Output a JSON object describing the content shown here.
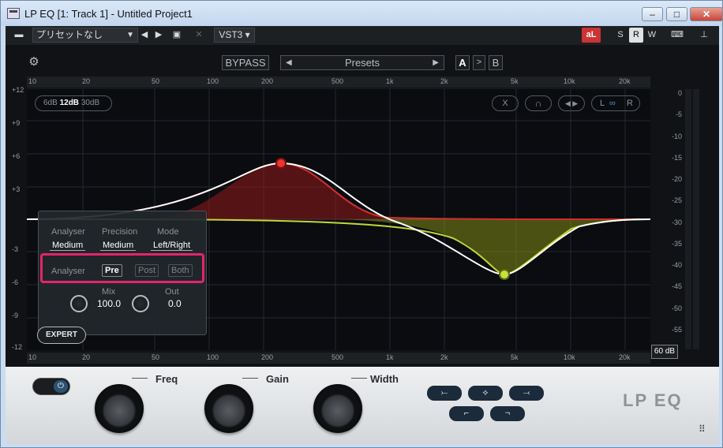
{
  "window": {
    "title": "LP EQ [1: Track 1] - Untitled Project1",
    "min_symbol": "–",
    "max_symbol": "□",
    "close_symbol": "✕"
  },
  "toolbar": {
    "preset_name": "プリセットなし",
    "format": "VST3",
    "buttons": [
      "S",
      "R",
      "W"
    ]
  },
  "plugin": {
    "bypass_label": "BYPASS",
    "presets_label": "Presets",
    "ab": [
      "A",
      "B"
    ],
    "range": {
      "options": [
        "6dB",
        "12dB",
        "30dB"
      ],
      "selected": "12dB"
    },
    "graph_buttons": [
      "X",
      "L",
      "R"
    ],
    "freq_ticks": [
      "10",
      "20",
      "50",
      "100",
      "200",
      "500",
      "1k",
      "2k",
      "5k",
      "10k",
      "20k"
    ],
    "gain_ticks": [
      "+12",
      "+9",
      "+6",
      "+3",
      "-3",
      "-6",
      "-9",
      "-12"
    ],
    "meter_ticks": [
      "0",
      "-5",
      "-10",
      "-15",
      "-20",
      "-25",
      "-30",
      "-35",
      "-40",
      "-45",
      "-50",
      "-55",
      "-60"
    ],
    "meter_range": "60 dB",
    "analyser_popup": {
      "headers": [
        "Analyser",
        "Precision",
        "Mode"
      ],
      "values": [
        "Medium",
        "Medium",
        "Left/Right"
      ],
      "source_label": "Analyser",
      "source_options": [
        "Pre",
        "Post",
        "Both"
      ],
      "source_selected": "Pre",
      "mix_label": "Mix",
      "mix_value": "100.0",
      "out_label": "Out",
      "out_value": "0.0"
    },
    "expert_label": "EXPERT",
    "knobs": [
      "Freq",
      "Gain",
      "Width"
    ],
    "logo": "LP EQ",
    "colors": {
      "band1": "#e23a3a",
      "band2": "#c8e03c",
      "highlight": "#e5246b"
    }
  }
}
